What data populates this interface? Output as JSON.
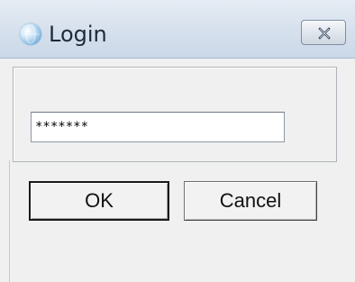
{
  "window": {
    "title": "Login",
    "icon": "app-globe-icon",
    "close_icon": "close-icon"
  },
  "form": {
    "password_value": "*******"
  },
  "buttons": {
    "ok_label": "OK",
    "cancel_label": "Cancel"
  },
  "colors": {
    "titlebar": "#d4dfec",
    "background": "#f0f0f0"
  }
}
